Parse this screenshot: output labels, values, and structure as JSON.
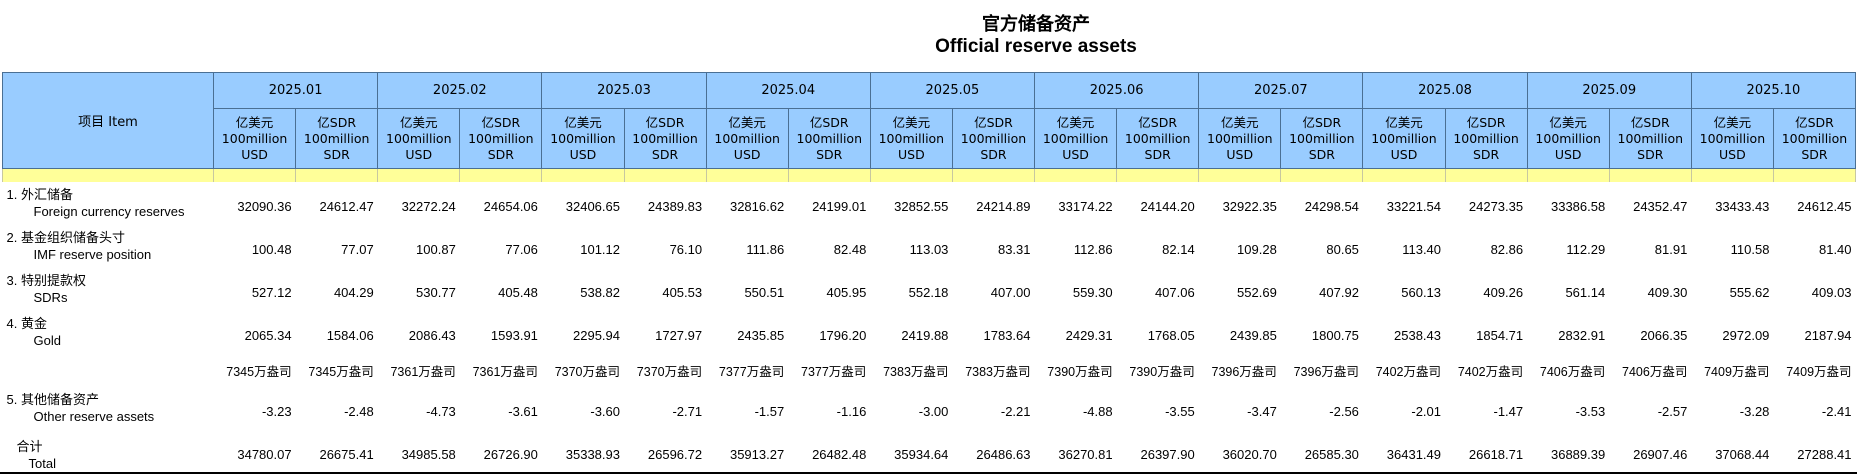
{
  "title": {
    "zh": "官方储备资产",
    "en": "Official reserve assets"
  },
  "header": {
    "item_label": "项目 Item",
    "months": [
      "2025.01",
      "2025.02",
      "2025.03",
      "2025.04",
      "2025.05",
      "2025.06",
      "2025.07",
      "2025.08",
      "2025.09",
      "2025.10"
    ],
    "unit_usd": [
      "亿美元",
      "100million",
      "USD"
    ],
    "unit_sdr": [
      "亿SDR",
      "100million",
      "SDR"
    ]
  },
  "rows": [
    {
      "label_zh": "1.  外汇储备",
      "label_en": "Foreign currency reserves",
      "values": [
        "32090.36",
        "24612.47",
        "32272.24",
        "24654.06",
        "32406.65",
        "24389.83",
        "32816.62",
        "24199.01",
        "32852.55",
        "24214.89",
        "33174.22",
        "24144.20",
        "32922.35",
        "24298.54",
        "33221.54",
        "24273.35",
        "33386.58",
        "24352.47",
        "33433.43",
        "24612.45"
      ]
    },
    {
      "label_zh": "2.  基金组织储备头寸",
      "label_en": "IMF reserve position",
      "values": [
        "100.48",
        "77.07",
        "100.87",
        "77.06",
        "101.12",
        "76.10",
        "111.86",
        "82.48",
        "113.03",
        "83.31",
        "112.86",
        "82.14",
        "109.28",
        "80.65",
        "113.40",
        "82.86",
        "112.29",
        "81.91",
        "110.58",
        "81.40"
      ]
    },
    {
      "label_zh": "3.  特别提款权",
      "label_en": "SDRs",
      "values": [
        "527.12",
        "404.29",
        "530.77",
        "405.48",
        "538.82",
        "405.53",
        "550.51",
        "405.95",
        "552.18",
        "407.00",
        "559.30",
        "407.06",
        "552.69",
        "407.92",
        "560.13",
        "409.26",
        "561.14",
        "409.30",
        "555.62",
        "409.03"
      ]
    },
    {
      "label_zh": "4.  黄金",
      "label_en": "Gold",
      "values": [
        "2065.34",
        "1584.06",
        "2086.43",
        "1593.91",
        "2295.94",
        "1727.97",
        "2435.85",
        "1796.20",
        "2419.88",
        "1783.64",
        "2429.31",
        "1768.05",
        "2439.85",
        "1800.75",
        "2538.43",
        "1854.71",
        "2832.91",
        "2066.35",
        "2972.09",
        "2187.94"
      ]
    },
    {
      "label_zh": "",
      "label_en": "",
      "oz": true,
      "values": [
        "7345万盎司",
        "7345万盎司",
        "7361万盎司",
        "7361万盎司",
        "7370万盎司",
        "7370万盎司",
        "7377万盎司",
        "7377万盎司",
        "7383万盎司",
        "7383万盎司",
        "7390万盎司",
        "7390万盎司",
        "7396万盎司",
        "7396万盎司",
        "7402万盎司",
        "7402万盎司",
        "7406万盎司",
        "7406万盎司",
        "7409万盎司",
        "7409万盎司"
      ]
    },
    {
      "label_zh": "5.  其他储备资产",
      "label_en": "Other reserve assets",
      "values": [
        "-3.23",
        "-2.48",
        "-4.73",
        "-3.61",
        "-3.60",
        "-2.71",
        "-1.57",
        "-1.16",
        "-3.00",
        "-2.21",
        "-4.88",
        "-3.55",
        "-3.47",
        "-2.56",
        "-2.01",
        "-1.47",
        "-3.53",
        "-2.57",
        "-3.28",
        "-2.41"
      ]
    },
    {
      "label_zh": "合计",
      "label_en": "Total",
      "total": true,
      "values": [
        "34780.07",
        "26675.41",
        "34985.58",
        "26726.90",
        "35338.93",
        "26596.72",
        "35913.27",
        "26482.48",
        "35934.64",
        "26486.63",
        "36270.81",
        "26397.90",
        "36020.70",
        "26585.30",
        "36431.49",
        "26618.71",
        "36889.39",
        "26907.46",
        "37068.44",
        "27288.41"
      ]
    }
  ]
}
